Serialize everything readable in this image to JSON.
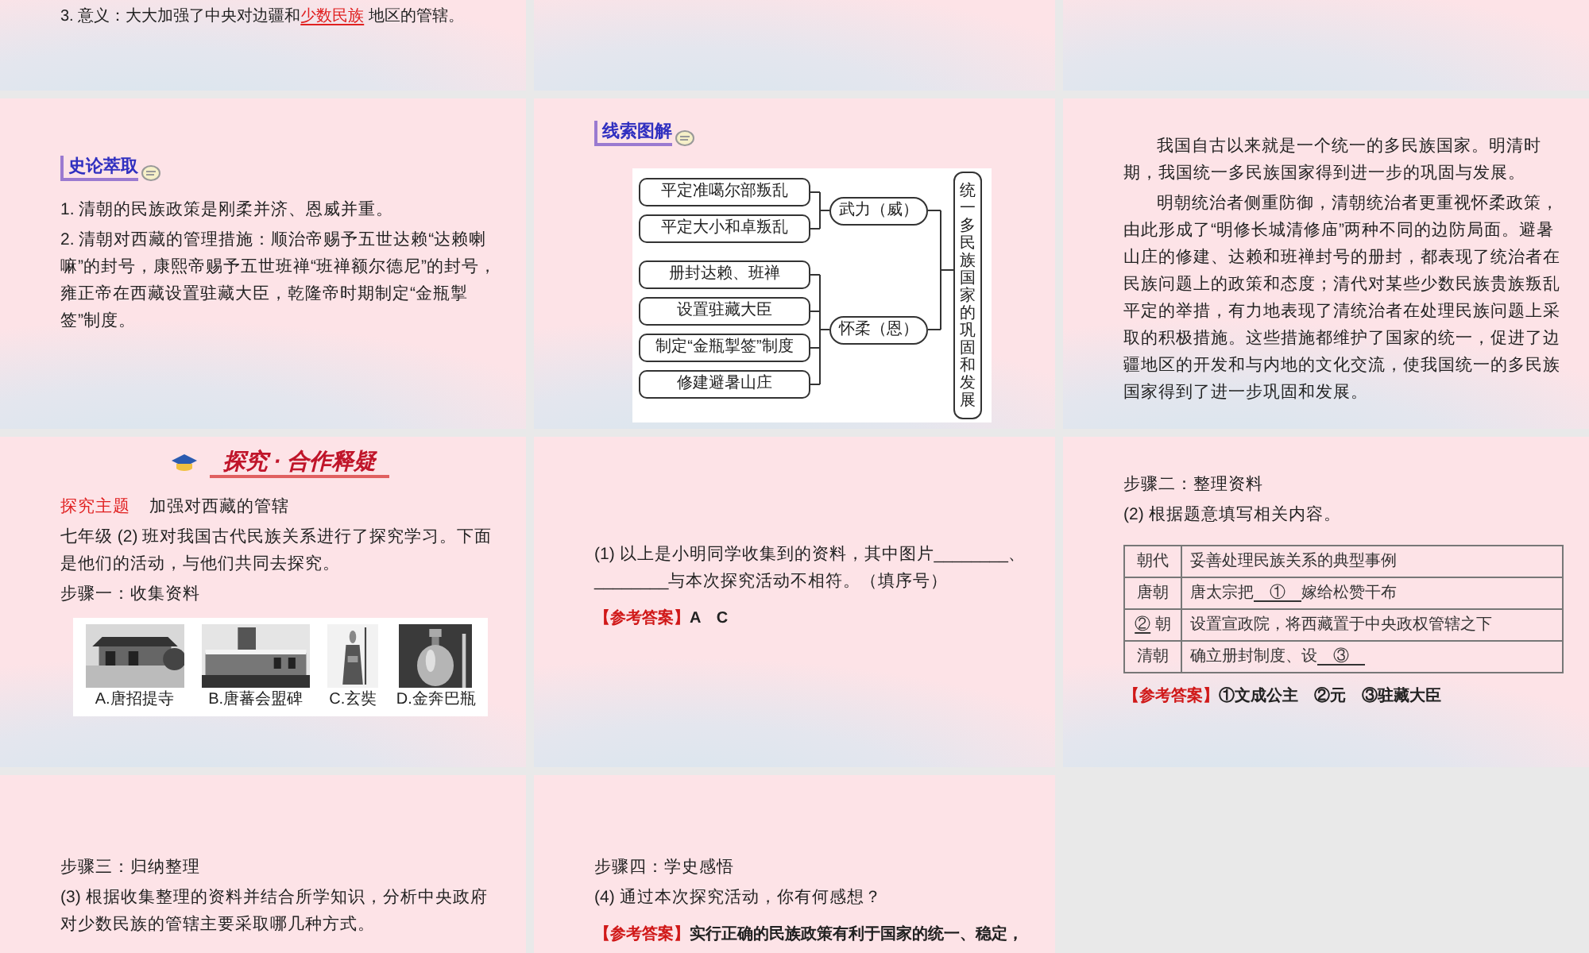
{
  "slides": [
    {
      "kind": "slide",
      "blocks": [
        {
          "kind": "para",
          "indent": false,
          "text": [
            {
              "text": "3. 意义：大大加强了中央对边疆和"
            },
            {
              "text": "少数民族",
              "kind": "key"
            },
            {
              "text": " 地区的管辖。"
            }
          ]
        }
      ]
    },
    {
      "kind": "slide"
    },
    {
      "kind": "slide"
    },
    {
      "kind": "slide",
      "blocks": [
        {
          "kind": "heading",
          "text": "史论萃取"
        },
        {
          "kind": "para",
          "indent": false,
          "text": "1. 清朝的民族政策是刚柔并济、恩威并重。"
        },
        {
          "kind": "para",
          "indent": false,
          "text": "2. 清朝对西藏的管理措施：顺治帝赐予五世达赖“达赖喇嘛”的封号，康熙帝赐予五世班禅“班禅额尔德尼”的封号，雍正帝在西藏设置驻藏大臣，乾隆帝时期制定“金瓶掣签”制度。"
        }
      ]
    },
    {
      "kind": "slide",
      "blocks": [
        {
          "kind": "heading",
          "text": "线索图解"
        },
        {
          "kind": "diagram",
          "groups": [
            {
              "label": "武力（威）",
              "items": [
                "平定准噶尔部叛乱",
                "平定大小和卓叛乱"
              ]
            },
            {
              "label": "怀柔（恩）",
              "items": [
                "册封达赖、班禅",
                "设置驻藏大臣",
                "制定“金瓶掣签”制度",
                "修建避暑山庄"
              ]
            }
          ],
          "result": "统一多民族国家的巩固和发展"
        }
      ]
    },
    {
      "kind": "slide",
      "blocks": [
        {
          "kind": "para",
          "indent": true,
          "text": "我国自古以来就是一个统一的多民族国家。明清时期，我国统一多民族国家得到进一步的巩固与发展。"
        },
        {
          "kind": "para",
          "indent": true,
          "text": "明朝统治者侧重防御，清朝统治者更重视怀柔政策，由此形成了“明修长城清修庙”两种不同的边防局面。避暑山庄的修建、达赖和班禅封号的册封，都表现了统治者在民族问题上的政策和态度；清代对某些少数民族贵族叛乱平定的举措，有力地表现了清统治者在处理民族问题上采取的积极措施。这些措施都维护了国家的统一，促进了边疆地区的开发和与内地的文化交流，使我国统一的多民族国家得到了进一步巩固和发展。"
        }
      ]
    },
    {
      "kind": "slide",
      "blocks": [
        {
          "kind": "banner",
          "text": "探究 · 合作释疑"
        },
        {
          "kind": "topic",
          "label": "探究主题",
          "text": "加强对西藏的管辖"
        },
        {
          "kind": "para",
          "indent": false,
          "text": "七年级 (2) 班对我国古代民族关系进行了探究学习。下面是他们的活动，与他们共同去探究。"
        },
        {
          "kind": "para",
          "indent": false,
          "text": "步骤一：收集资料"
        },
        {
          "kind": "figures",
          "items": [
            {
              "caption": "A.唐招提寺"
            },
            {
              "caption": "B.唐蕃会盟碑"
            },
            {
              "caption": "C.玄奘"
            },
            {
              "caption": "D.金奔巴瓶"
            }
          ]
        }
      ]
    },
    {
      "kind": "slide",
      "blocks": [
        {
          "kind": "para",
          "indent": false,
          "text": "(1) 以上是小明同学收集到的资料，其中图片________、________与本次探究活动不相符。（填序号）"
        },
        {
          "kind": "answer",
          "label": "【参考答案】",
          "text": "A　C"
        }
      ]
    },
    {
      "kind": "slide",
      "blocks": [
        {
          "kind": "para",
          "indent": false,
          "text": "步骤二：整理资料"
        },
        {
          "kind": "para",
          "indent": false,
          "text": "(2) 根据题意填写相关内容。"
        },
        {
          "kind": "table",
          "rows": [
            [
              "朝代",
              "妥善处理民族关系的典型事例"
            ],
            [
              "唐朝",
              [
                {
                  "text": "唐太宗把"
                },
                {
                  "text": "　①　",
                  "kind": "blank"
                },
                {
                  "text": "嫁给松赞干布"
                }
              ]
            ],
            [
              [
                {
                  "text": "②",
                  "kind": "blank"
                },
                {
                  "text": " 朝"
                }
              ],
              "设置宣政院，将西藏置于中央政权管辖之下"
            ],
            [
              "清朝",
              [
                {
                  "text": "确立册封制度、设"
                },
                {
                  "text": "　③　",
                  "kind": "blank"
                }
              ]
            ]
          ]
        },
        {
          "kind": "answer",
          "label": "【参考答案】",
          "text": "①文成公主　②元　③驻藏大臣"
        }
      ]
    },
    {
      "kind": "slide",
      "blocks": [
        {
          "kind": "para",
          "indent": false,
          "text": "步骤三：归纳整理"
        },
        {
          "kind": "para",
          "indent": false,
          "text": "(3) 根据收集整理的资料并结合所学知识，分析中央政府对少数民族的管辖主要采取哪几种方式。"
        }
      ]
    },
    {
      "kind": "slide",
      "blocks": [
        {
          "kind": "para",
          "indent": false,
          "text": "步骤四：学史感悟"
        },
        {
          "kind": "para",
          "indent": false,
          "text": "(4) 通过本次探究活动，你有何感想？"
        },
        {
          "kind": "answer",
          "label": "【参考答案】",
          "text": "实行正确的民族政策有利于国家的统一、稳定，"
        }
      ]
    }
  ]
}
